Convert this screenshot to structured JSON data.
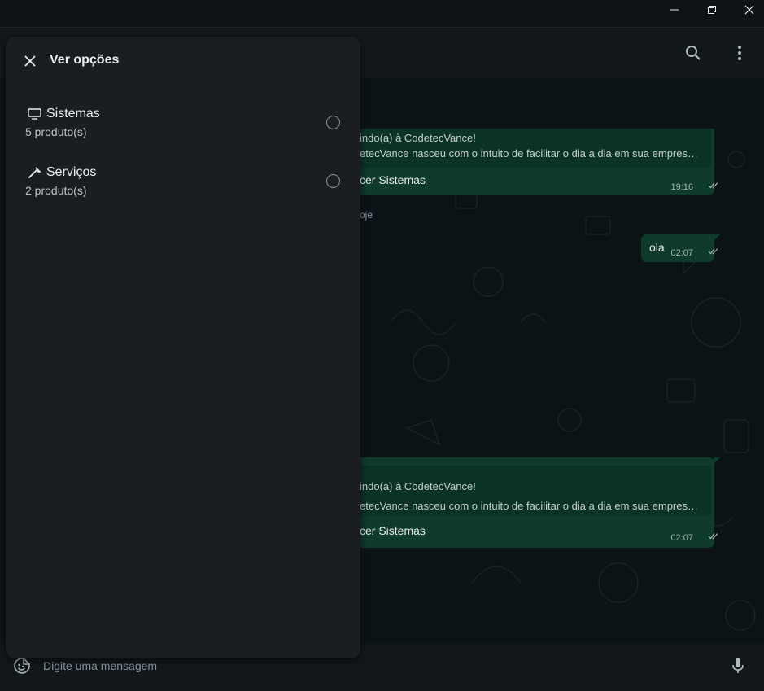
{
  "window": {
    "minimize_icon": "minimize-icon",
    "maximize_icon": "restore-icon",
    "close_icon": "close-icon"
  },
  "header": {
    "search_icon": "search-icon",
    "menu_icon": "kebab-menu-icon"
  },
  "messages": [
    {
      "id": "welcome-1",
      "line1": "indo(a) à CodetecVance!",
      "line2": "etecVance nasceu com o intuito de facilitar o dia a dia em sua empres…",
      "button": "cer Sistemas",
      "time": "19:16"
    },
    {
      "id": "ola",
      "text": "ola",
      "time": "02:07"
    },
    {
      "id": "welcome-2",
      "line1": "indo(a) à CodetecVance!",
      "line2": "etecVance nasceu com o intuito de facilitar o dia a dia em sua empres…",
      "button": "cer Sistemas",
      "time": "02:07"
    }
  ],
  "day_label": "oje",
  "composer": {
    "placeholder": "Digite uma mensagem",
    "emoji_icon": "sticker-emoji-icon",
    "mic_icon": "microphone-icon"
  },
  "panel": {
    "title": "Ver opções",
    "close_icon": "close-icon",
    "options": [
      {
        "icon": "monitor-icon",
        "name": "Sistemas",
        "count": "5 produto(s)"
      },
      {
        "icon": "wrench-icon",
        "name": "Serviços",
        "count": "2 produto(s)"
      }
    ]
  },
  "colors": {
    "background": "#0b1014",
    "header": "#121719",
    "bubble": "#0e3b2b",
    "panel": "#1b1e20",
    "secondary_text": "#8696a0"
  }
}
